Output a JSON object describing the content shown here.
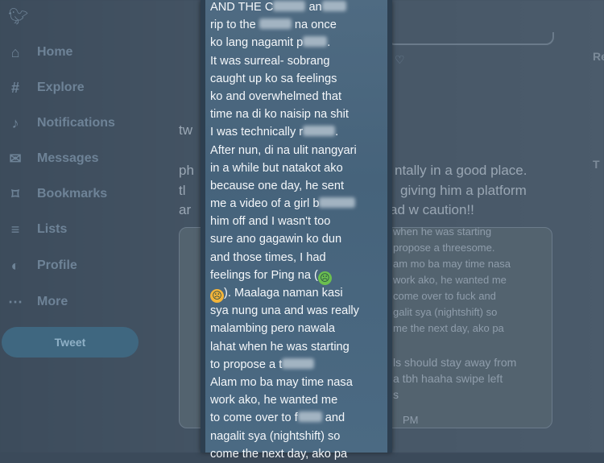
{
  "nav": {
    "items": [
      {
        "icon": "home-icon",
        "glyph": "⌂",
        "label": "Home"
      },
      {
        "icon": "explore-icon",
        "glyph": "#",
        "label": "Explore"
      },
      {
        "icon": "bell-icon",
        "glyph": "♪",
        "label": "Notifications"
      },
      {
        "icon": "mail-icon",
        "glyph": "✉",
        "label": "Messages"
      },
      {
        "icon": "bookmark-icon",
        "glyph": "⌑",
        "label": "Bookmarks"
      },
      {
        "icon": "list-icon",
        "glyph": "≡",
        "label": "Lists"
      },
      {
        "icon": "profile-icon",
        "glyph": "◐",
        "label": "Profile"
      },
      {
        "icon": "more-icon",
        "glyph": "⋯",
        "label": "More"
      }
    ],
    "tweet_label": "Tweet"
  },
  "feed": {
    "tw": "tw",
    "line1_left": "ph",
    "line1_right": "ntally in a good place.",
    "line2_left": "tl",
    "line2_right": "giving him a platform",
    "line3_left": "ar",
    "line3_right": "ad w caution!!"
  },
  "quote": {
    "lines": [
      "when he was starting",
      "propose a threesome.",
      "am mo ba may time nasa",
      "work ako, he wanted me",
      "come over to fuck and",
      "galit sya (nightshift) so",
      "me the next day, ako pa"
    ],
    "reply_lines": [
      "ls should stay away from",
      "a tbh haaha swipe left",
      "s"
    ],
    "time": "PM"
  },
  "screenshot": {
    "lines": [
      [
        "AND THE C",
        "#blur",
        " an",
        "#blur"
      ],
      [
        "rip to the ",
        "#blur",
        " na once"
      ],
      [
        "ko lang nagamit p",
        "#blur",
        "."
      ],
      [
        "It was surreal- sobrang"
      ],
      [
        "caught up ko sa feelings"
      ],
      [
        "ko and overwhelmed that"
      ],
      [
        "time na di ko naisip na shit"
      ],
      [
        "I was technically r",
        "#blur",
        "."
      ],
      [
        "After nun, di na ulit nangyari"
      ],
      [
        "in a while but natakot ako"
      ],
      [
        "because one day, he sent"
      ],
      [
        "me a video of a girl b",
        "#blur"
      ],
      [
        "him off and I wasn't too"
      ],
      [
        "sure ano gagawin ko dun"
      ],
      [
        "and those times, I had"
      ],
      [
        "feelings for Ping na (",
        "#green",
        ""
      ],
      [
        "#orange",
        "). Maalaga naman kasi"
      ],
      [
        "sya nung una and was really"
      ],
      [
        "malambing pero nawala"
      ],
      [
        "lahat when he was starting"
      ],
      [
        "to propose a t",
        "#blur"
      ],
      [
        "Alam mo ba may time nasa"
      ],
      [
        "work ako, he wanted me"
      ],
      [
        "to come over to f",
        "#blur",
        " and"
      ],
      [
        "nagalit sya (nightshift) so"
      ],
      [
        "come the next day, ako pa"
      ]
    ]
  }
}
